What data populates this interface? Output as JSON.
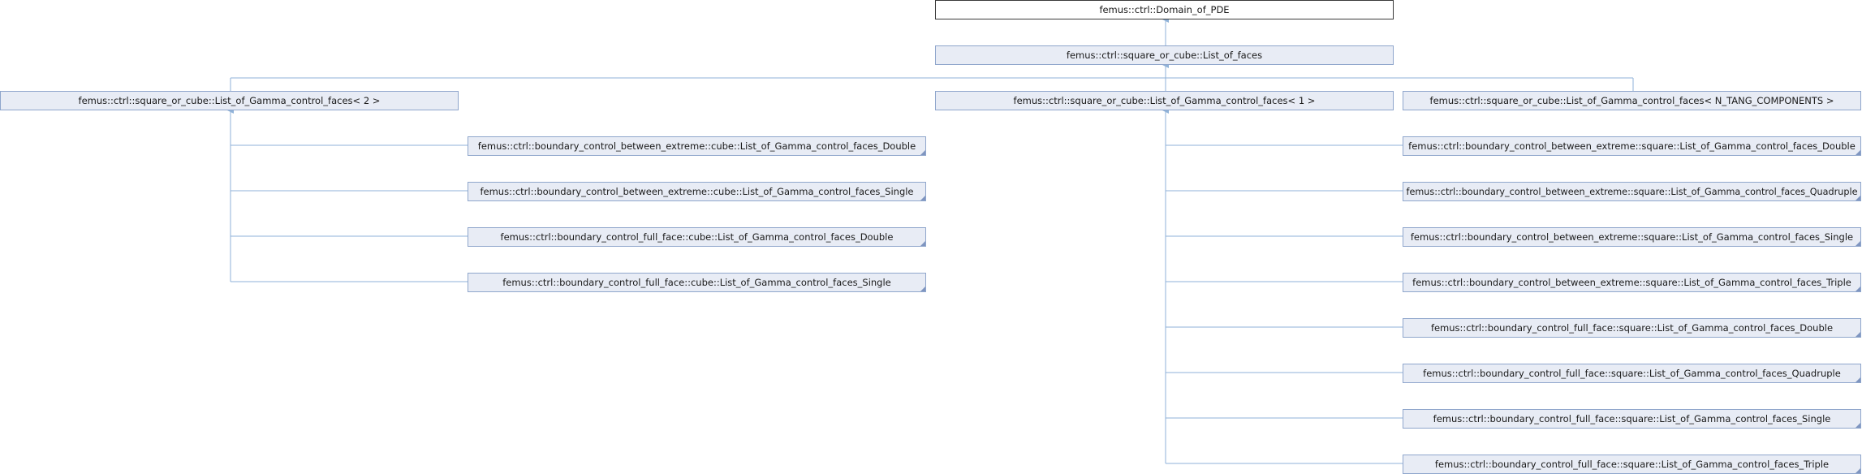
{
  "diagram": {
    "root": "femus::ctrl::Domain_of_PDE",
    "level1": "femus::ctrl::square_or_cube::List_of_faces",
    "level2": [
      "femus::ctrl::square_or_cube::List_of_Gamma_control_faces< 2 >",
      "femus::ctrl::square_or_cube::List_of_Gamma_control_faces< 1 >",
      "femus::ctrl::square_or_cube::List_of_Gamma_control_faces< N_TANG_COMPONENTS >"
    ],
    "cube_children": [
      "femus::ctrl::boundary_control_between_extreme::cube::List_of_Gamma_control_faces_Double",
      "femus::ctrl::boundary_control_between_extreme::cube::List_of_Gamma_control_faces_Single",
      "femus::ctrl::boundary_control_full_face::cube::List_of_Gamma_control_faces_Double",
      "femus::ctrl::boundary_control_full_face::cube::List_of_Gamma_control_faces_Single"
    ],
    "square_children": [
      "femus::ctrl::boundary_control_between_extreme::square::List_of_Gamma_control_faces_Double",
      "femus::ctrl::boundary_control_between_extreme::square::List_of_Gamma_control_faces_Quadruple",
      "femus::ctrl::boundary_control_between_extreme::square::List_of_Gamma_control_faces_Single",
      "femus::ctrl::boundary_control_between_extreme::square::List_of_Gamma_control_faces_Triple",
      "femus::ctrl::boundary_control_full_face::square::List_of_Gamma_control_faces_Double",
      "femus::ctrl::boundary_control_full_face::square::List_of_Gamma_control_faces_Quadruple",
      "femus::ctrl::boundary_control_full_face::square::List_of_Gamma_control_faces_Single",
      "femus::ctrl::boundary_control_full_face::square::List_of_Gamma_control_faces_Triple"
    ]
  },
  "colors": {
    "edge": "#8fb2d8",
    "box_fill": "#e8ecf5",
    "box_border": "#8fa6cc",
    "root_border": "#3a3a3a"
  }
}
